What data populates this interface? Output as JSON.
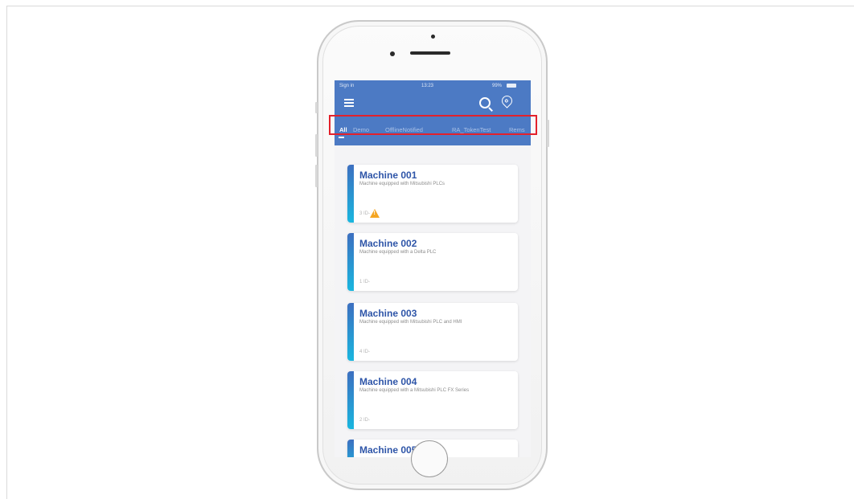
{
  "status_bar": {
    "carrier": "Sign in",
    "time": "13:23",
    "battery": "99%"
  },
  "tabs": [
    {
      "label": "All",
      "active": true
    },
    {
      "label": "Demo",
      "active": false
    },
    {
      "label": "OfflineNotified",
      "active": false
    },
    {
      "label": "RA_TokenTest",
      "active": false
    },
    {
      "label": "Rems",
      "active": false
    }
  ],
  "machines": [
    {
      "name": "Machine 001",
      "description": "Machine equipped with Mitsubishi PLCs",
      "meta": "3 ID-",
      "warning": true
    },
    {
      "name": "Machine 002",
      "description": "Machine equipped with a Delta PLC",
      "meta": "1 ID-",
      "warning": false
    },
    {
      "name": "Machine 003",
      "description": "Machine equipped with Mitsubishi PLC and HMI",
      "meta": "4 ID-",
      "warning": false
    },
    {
      "name": "Machine 004",
      "description": "Machine equipped with a Mitsubishi PLC FX Series",
      "meta": "2 ID-",
      "warning": false
    },
    {
      "name": "Machine 005",
      "description": "",
      "meta": "",
      "warning": false
    }
  ],
  "colors": {
    "header": "#4c7ac4",
    "accent_title": "#2e55a8",
    "highlight": "#e3212b",
    "warning": "#f5a623"
  }
}
